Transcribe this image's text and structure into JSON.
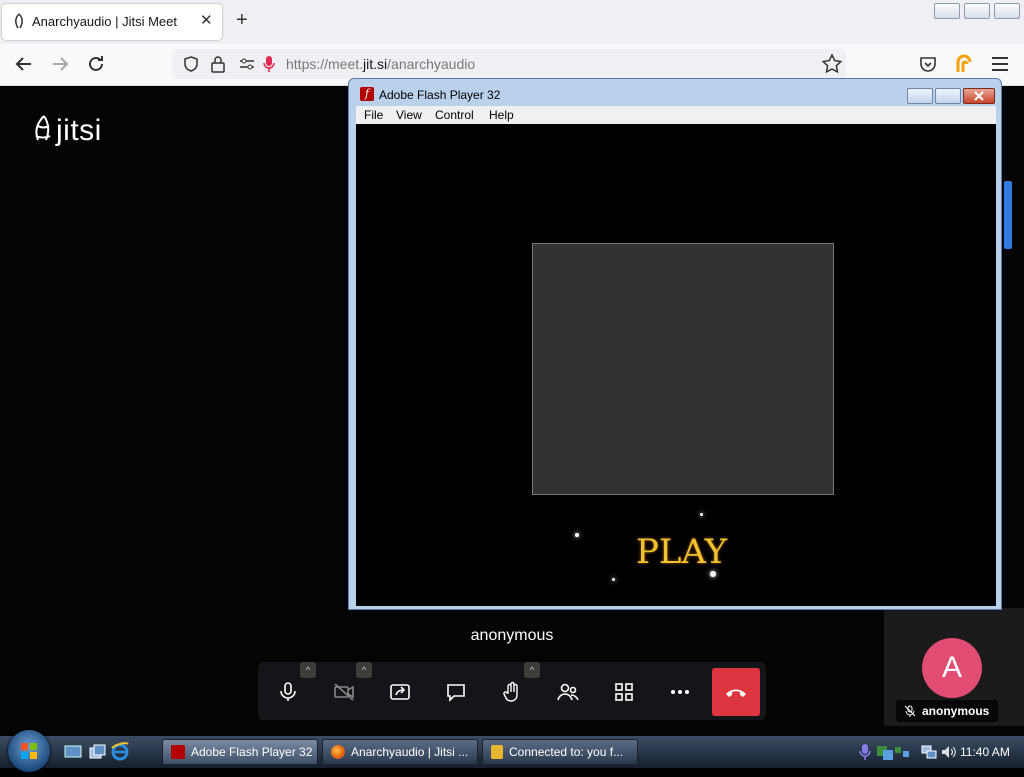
{
  "browser": {
    "tab_title": "Anarchyaudio | Jitsi Meet",
    "tab_close": "✕",
    "new_tab": "+",
    "url_prefix": "https://meet.",
    "url_domain": "jit.si",
    "url_path": "/anarchyaudio"
  },
  "page": {
    "logo_text": "jitsi",
    "participant_name": "anonymous",
    "thumbnail": {
      "avatar_letter": "A",
      "name": "anonymous"
    },
    "toolbar": [
      "microphone",
      "camera-off",
      "share-screen",
      "chat",
      "raise-hand",
      "participants",
      "tile-view",
      "more",
      "hang-up"
    ]
  },
  "flash_window": {
    "title": "Adobe Flash Player 32",
    "icon_letter": "f",
    "menu": [
      "File",
      "View",
      "Control",
      "Help"
    ],
    "play_label": "PLAY"
  },
  "taskbar": {
    "items": [
      "Adobe Flash Player 32",
      "Anarchyaudio | Jitsi ...",
      "Connected to: you f..."
    ],
    "clock": "11:40 AM"
  },
  "colors": {
    "hangup": "#dd3540",
    "avatar": "#e44d73",
    "play_text": "#f1c232"
  }
}
